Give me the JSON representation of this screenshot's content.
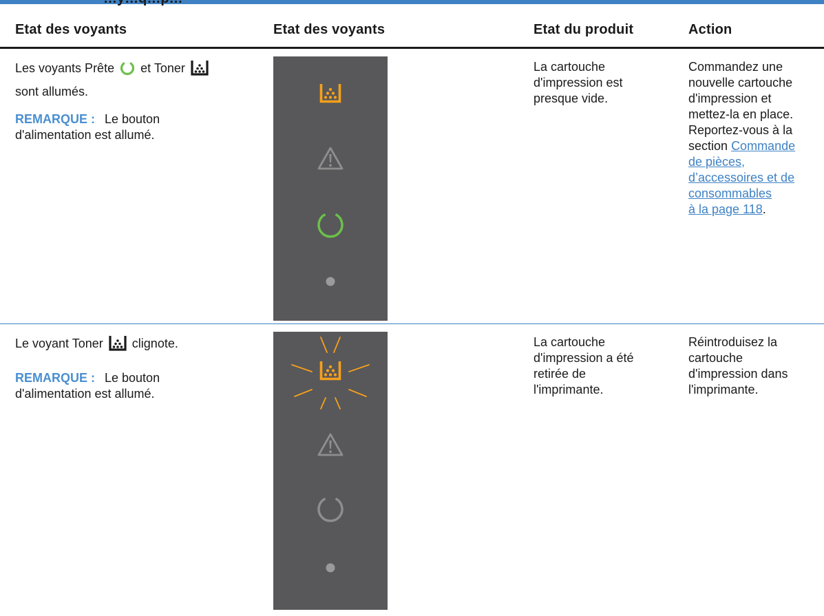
{
  "header": {
    "cut_text": "…y…q…p…",
    "columns": [
      "Etat des voyants",
      "Etat des voyants",
      "Etat du produit",
      "Action"
    ]
  },
  "rows": [
    {
      "light_state_before": "Les voyants Prête",
      "light_state_middle": "et Toner",
      "light_state_after": "sont allumés.",
      "note_label": "REMARQUE :",
      "note_text_1": "Le bouton",
      "note_text_2": "d'alimentation est allumé.",
      "product_state": [
        "La cartouche",
        "d'impression est",
        "presque vide."
      ],
      "action_lines": [
        "Commandez une",
        "nouvelle cartouche",
        "d'impression et",
        "mettez-la en place.",
        "Reportez-vous à la"
      ],
      "action_prefix": "section",
      "link_lines": [
        "Commande",
        "de pièces,",
        "d’accessoires et de",
        "consommables",
        "à la page 118"
      ],
      "action_suffix": ".",
      "panel": {
        "toner": "on",
        "attention": "off",
        "ready": "on",
        "power": "off"
      }
    },
    {
      "light_state_before": "Le voyant Toner",
      "light_state_after": "clignote.",
      "note_label": "REMARQUE :",
      "note_text_1": "Le bouton",
      "note_text_2": "d'alimentation est allumé.",
      "product_state": [
        "La cartouche",
        "d'impression a été",
        "retirée de",
        "l'imprimante."
      ],
      "action_lines": [
        "Réintroduisez la",
        "cartouche",
        "d'impression dans",
        "l'imprimante."
      ],
      "panel": {
        "toner": "blinking",
        "attention": "off",
        "ready": "off",
        "power": "off"
      }
    }
  ],
  "colors": {
    "accent_blue": "#3f82c4",
    "panel_gray": "#58585a",
    "toner_amber": "#f6a01a",
    "ready_green": "#6cc04a",
    "off_gray": "#8e8e8e"
  }
}
